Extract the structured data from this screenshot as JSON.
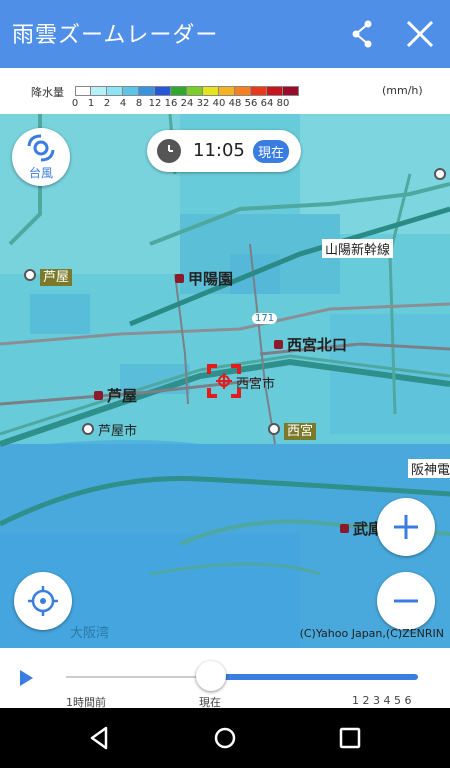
{
  "app": {
    "title": "雨雲ズームレーダー"
  },
  "header_icons": {
    "share": "share-icon",
    "close": "close-icon"
  },
  "legend": {
    "label": "降水量",
    "unit": "(mm/h)",
    "ticks": [
      "0",
      "1",
      "2",
      "4",
      "8",
      "12",
      "16",
      "24",
      "32",
      "40",
      "48",
      "56",
      "64",
      "80"
    ],
    "colors": [
      "#ffffff",
      "#b7f0f7",
      "#8de4f4",
      "#5bc6e9",
      "#3a93e0",
      "#2657d9",
      "#2ea82e",
      "#7ccd2a",
      "#e5e51f",
      "#f5b324",
      "#f5801f",
      "#e83a1a",
      "#c7141d",
      "#9a0d2a"
    ]
  },
  "map": {
    "time": "11:05",
    "now_badge": "現在",
    "typhoon_label": "台風",
    "places": {
      "koyoen": "甲陽園",
      "ashiya_station": "芦屋",
      "ashiya_tag": "芦屋",
      "ashiyashi": "芦屋市",
      "nishinomiya_kitaguchi": "西宮北口",
      "nishinomiyashi": "西宮市",
      "nishinomiya_tag": "西宮",
      "sanyo_shinkansen": "山陽新幹線",
      "hanshin": "阪神電",
      "mukonoso": "武庫",
      "osaka_bay": "大阪湾",
      "route171": "171"
    },
    "credit": "(C)Yahoo Japan,(C)ZENRIN"
  },
  "timeline": {
    "label_past": "1時間前",
    "label_now": "現在",
    "label_future": "1 2 3 4 5 6"
  },
  "nav": {
    "back": "back-icon",
    "home": "home-icon",
    "recents": "recents-icon"
  }
}
